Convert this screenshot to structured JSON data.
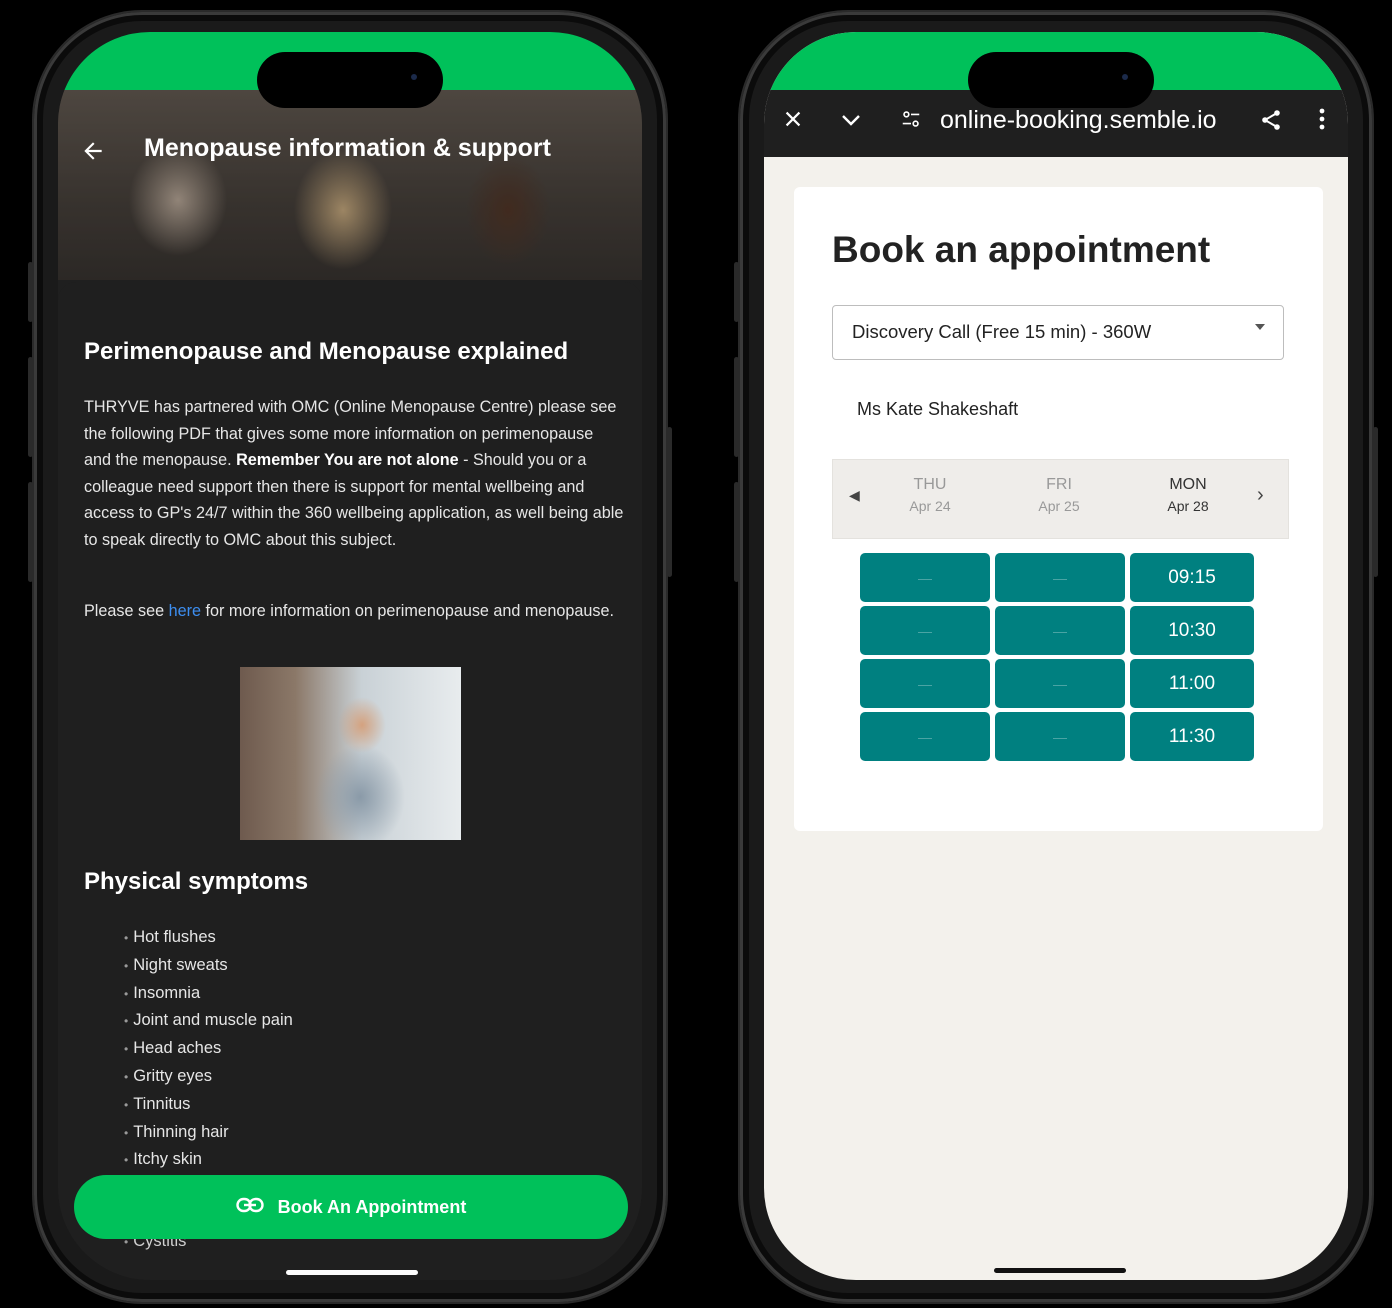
{
  "colors": {
    "brand_green": "#00c15a",
    "teal": "#008080"
  },
  "left_app": {
    "header_title": "Menopause information & support",
    "back_icon": "arrow-left-icon",
    "section1_title": "Perimenopause and Menopause explained",
    "para1_start": "THRYVE has partnered with OMC (Online Menopause Centre) please see the following PDF that gives some more information on perimenopause and the menopause. ",
    "para1_bold": "Remember You are not alone",
    "para1_end": " - Should you or a colleague need support then there is support for mental wellbeing and access to GP's 24/7 within the 360 wellbeing application, as well being able to speak directly to OMC about this subject.",
    "para2_start": "Please see ",
    "para2_link": "here",
    "para2_end": " for more information on perimenopause and menopause.",
    "section2_title": "Physical symptoms",
    "symptoms": [
      "Hot flushes",
      "Night sweats",
      "Insomnia",
      "Joint and muscle pain",
      "Head aches",
      "Gritty eyes",
      "Tinnitus",
      "Thinning hair",
      "Itchy skin"
    ],
    "partial_item": "Cystitis",
    "book_button_label": "Book An Appointment",
    "book_button_icon": "link-icon"
  },
  "right_app": {
    "url": "online-booking.semble.io",
    "close_icon": "close-icon",
    "collapse_icon": "chevron-down-icon",
    "site_settings_icon": "tune-icon",
    "share_icon": "share-icon",
    "menu_icon": "more-vertical-icon",
    "title": "Book an appointment",
    "service_select": "Discovery Call (Free 15 min) - 360W",
    "practitioner": "Ms Kate Shakeshaft",
    "dates": [
      {
        "dow": "THU",
        "day": "Apr 24"
      },
      {
        "dow": "FRI",
        "day": "Apr 25"
      },
      {
        "dow": "MON",
        "day": "Apr 28"
      }
    ],
    "empty_slot": "—",
    "times": [
      "09:15",
      "10:30",
      "11:00",
      "11:30"
    ]
  }
}
